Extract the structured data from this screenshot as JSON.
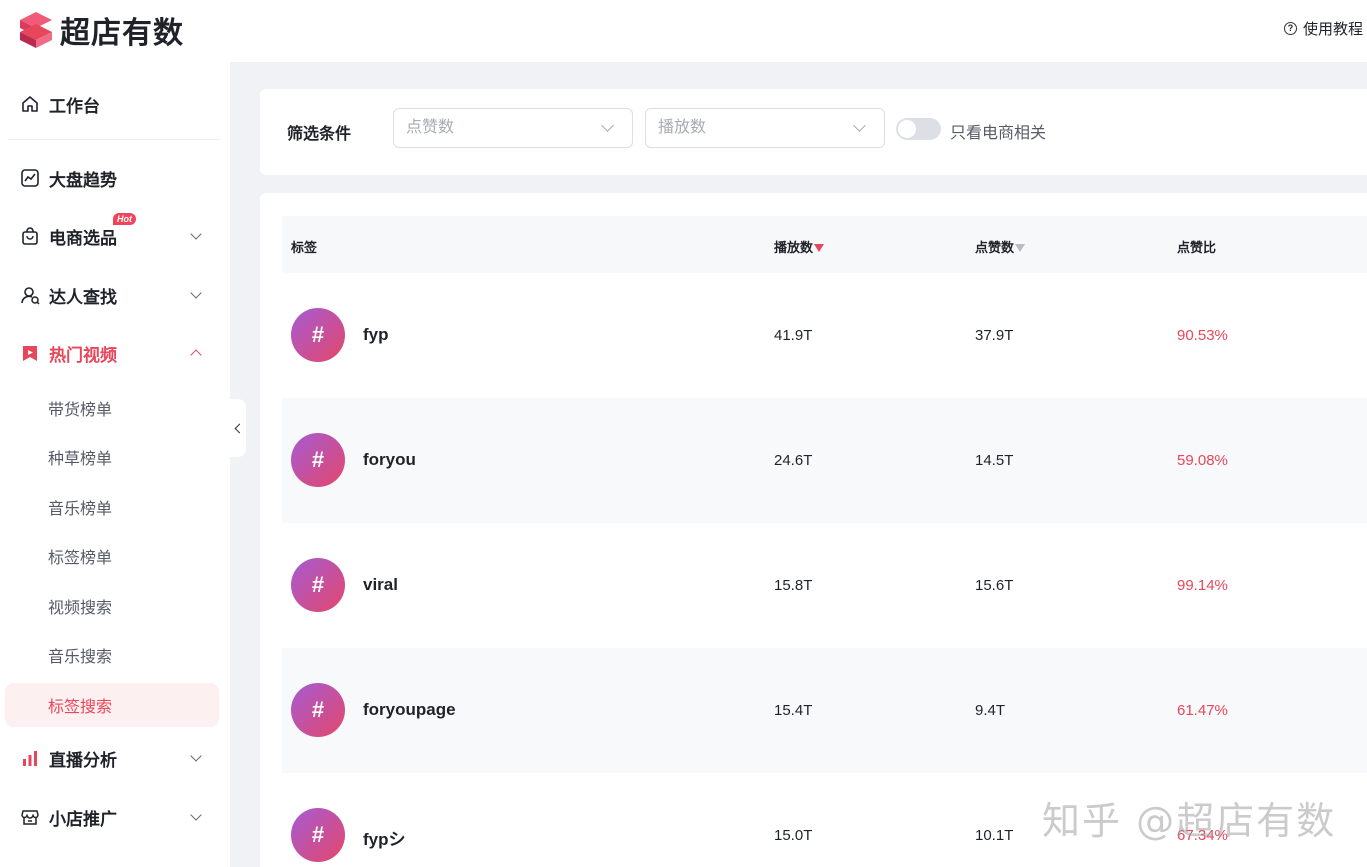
{
  "app": {
    "name": "超店有数",
    "help_label": "使用教程"
  },
  "sidebar": {
    "items": [
      {
        "label": "工作台",
        "icon": "home-icon"
      },
      {
        "label": "大盘趋势",
        "icon": "trend-chart-icon"
      },
      {
        "label": "电商选品",
        "icon": "shopping-bag-icon",
        "badge": "Hot"
      },
      {
        "label": "达人查找",
        "icon": "user-search-icon"
      },
      {
        "label": "热门视频",
        "icon": "video-bookmark-icon"
      },
      {
        "label": "直播分析",
        "icon": "bar-chart-icon"
      },
      {
        "label": "小店推广",
        "icon": "store-icon"
      }
    ],
    "sub_items": [
      "带货榜单",
      "种草榜单",
      "音乐榜单",
      "标签榜单",
      "视频搜索",
      "音乐搜索",
      "标签搜索"
    ],
    "active_sub": "标签搜索"
  },
  "filter": {
    "label": "筛选条件",
    "likes_placeholder": "点赞数",
    "plays_placeholder": "播放数",
    "toggle_label": "只看电商相关"
  },
  "table": {
    "headers": {
      "tag": "标签",
      "plays": "播放数",
      "likes": "点赞数",
      "ratio": "点赞比"
    },
    "rows": [
      {
        "symbol": "#",
        "tag": "fyp",
        "plays": "41.9T",
        "likes": "37.9T",
        "ratio": "90.53%"
      },
      {
        "symbol": "#",
        "tag": "foryou",
        "plays": "24.6T",
        "likes": "14.5T",
        "ratio": "59.08%"
      },
      {
        "symbol": "#",
        "tag": "viral",
        "plays": "15.8T",
        "likes": "15.6T",
        "ratio": "99.14%"
      },
      {
        "symbol": "#",
        "tag": "foryoupage",
        "plays": "15.4T",
        "likes": "9.4T",
        "ratio": "61.47%"
      },
      {
        "symbol": "#",
        "tag": "fypシ",
        "plays": "15.0T",
        "likes": "10.1T",
        "ratio": "67.34%"
      }
    ]
  },
  "watermark": "知乎 @超店有数",
  "colors": {
    "accent": "#e8465a",
    "avatar_start": "#a55bd4",
    "avatar_end": "#e4476a",
    "background": "#f0f2f5"
  }
}
